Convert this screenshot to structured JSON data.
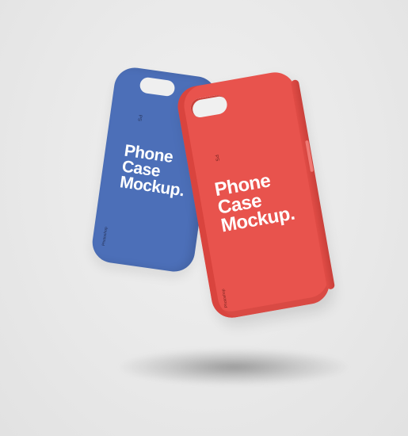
{
  "scene": {
    "background_color": "#ebebeb"
  },
  "cases": {
    "blue": {
      "color": "#4c6fb8",
      "headline": [
        "Phone",
        "Case",
        "Mockup."
      ],
      "small_top_text": "PS",
      "small_bottom_text": "Photoshop"
    },
    "red": {
      "color": "#e8534d",
      "headline": [
        "Phone",
        "Case",
        "Mockup."
      ],
      "small_top_text": "PS",
      "small_bottom_text": "Photoshop"
    }
  }
}
